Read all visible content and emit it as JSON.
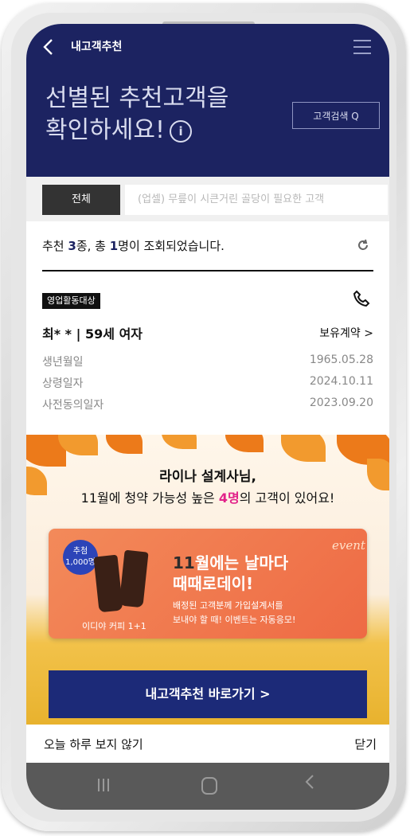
{
  "header": {
    "title": "내고객추천",
    "hero_line1": "선별된 추천고객을",
    "hero_line2": "확인하세요!",
    "search_label": "고객검색 Q"
  },
  "tabs": {
    "all": "전체",
    "other": "(업셀) 무릎이 시큰거린 골당이 필요한 고객"
  },
  "summary": {
    "prefix": "추천 ",
    "kinds": "3",
    "middle": "종, 총 ",
    "count": "1",
    "suffix": "명이 조회되었습니다."
  },
  "customer": {
    "badge": "영업활동대상",
    "name": "최* *  |  59세 여자",
    "contract_link": "보유계약 >",
    "rows": [
      {
        "label": "생년월일",
        "value": "1965.05.28"
      },
      {
        "label": "상령일자",
        "value": "2024.10.11"
      },
      {
        "label": "사전동의일자",
        "value": "2023.09.20"
      }
    ]
  },
  "popup": {
    "line1": "라이나 설계사님,",
    "line2_prefix": "11월에 청약 가능성 높은 ",
    "line2_highlight": "4명",
    "line2_suffix": "의 고객이 있어요!",
    "banner": {
      "raffle_line1": "추첨",
      "raffle_line2": "1,000명",
      "product": "이디야 커피 1+1",
      "event_tag": "event",
      "title_hl": "11",
      "title_rest": "월에는 날마다",
      "title_line2": "때때로데이!",
      "desc_line1": "배정된 고객분께 가입설계서를",
      "desc_line2": "보내야 할 때! 이벤트는 자동응모!"
    },
    "cta_label": "내고객추천 바로가기  >",
    "dont_show_today": "오늘 하루 보지 않기",
    "close_label": "닫기"
  },
  "colors": {
    "header_bg": "#1c2361",
    "cta_bg": "#1c2a78",
    "highlight_pink": "#e2238a",
    "banner_orange": "#ee6a44"
  }
}
